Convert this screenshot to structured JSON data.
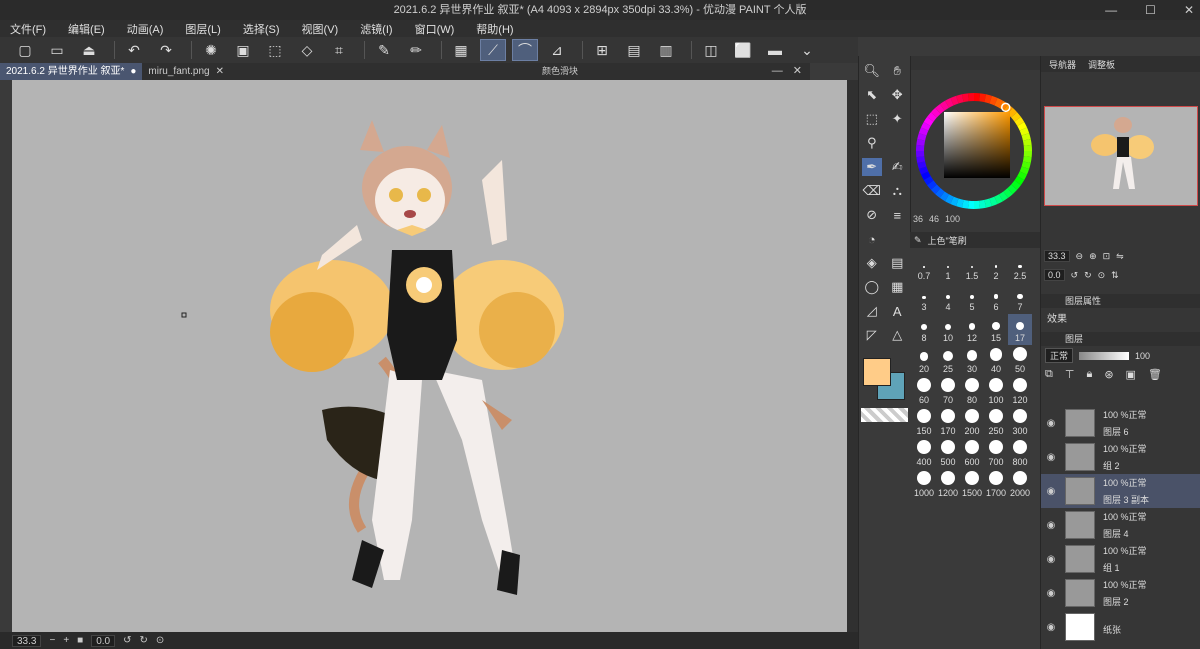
{
  "window": {
    "title": "2021.6.2 异世界作业 叙亚* (A4 4093 x 2894px 350dpi 33.3%)  - 优动漫 PAINT 个人版"
  },
  "menu": [
    "文件(F)",
    "编辑(E)",
    "动画(A)",
    "图层(L)",
    "选择(S)",
    "视图(V)",
    "滤镜(I)",
    "窗口(W)",
    "帮助(H)"
  ],
  "tabs": [
    {
      "label": "2021.6.2 异世界作业 叙亚*"
    },
    {
      "label": "miru_fant.png"
    }
  ],
  "color_slider_title": "颜色滑块",
  "status": {
    "zoom": "33.3",
    "angle": "0.0"
  },
  "color": {
    "main": "#ffcc88",
    "sub": "#5fa3b8",
    "h": "36",
    "s": "46",
    "v": "100",
    "wheel_hue": "36"
  },
  "brush_panel": {
    "tab_label": "上色\"笔刷"
  },
  "brush_sizes": [
    "0.7",
    "1",
    "1.5",
    "2",
    "2.5",
    "3",
    "4",
    "5",
    "6",
    "7",
    "8",
    "10",
    "12",
    "15",
    "17",
    "20",
    "25",
    "30",
    "40",
    "50",
    "60",
    "70",
    "80",
    "100",
    "120",
    "150",
    "170",
    "200",
    "250",
    "300",
    "400",
    "500",
    "600",
    "700",
    "800",
    "1000",
    "1200",
    "1500",
    "1700",
    "2000"
  ],
  "brush_selected": "17",
  "navigator": {
    "tab1": "导航器",
    "tab2": "调整板",
    "zoom": "33.3",
    "angle": "0.0"
  },
  "layer_property": {
    "title": "图层属性",
    "effect_label": "效果"
  },
  "layer_panel": {
    "title": "图层",
    "blend_mode": "正常",
    "opacity": "100"
  },
  "layers": [
    {
      "opacity": "100 %正常",
      "name": "图层 6",
      "selected": false
    },
    {
      "opacity": "100 %正常",
      "name": "组 2",
      "selected": false
    },
    {
      "opacity": "100 %正常",
      "name": "图层 3 副本",
      "selected": true
    },
    {
      "opacity": "100 %正常",
      "name": "图层 4",
      "selected": false
    },
    {
      "opacity": "100 %正常",
      "name": "组 1",
      "selected": false
    },
    {
      "opacity": "100 %正常",
      "name": "图层 2",
      "selected": false
    },
    {
      "opacity": "",
      "name": "纸张",
      "selected": false
    }
  ]
}
